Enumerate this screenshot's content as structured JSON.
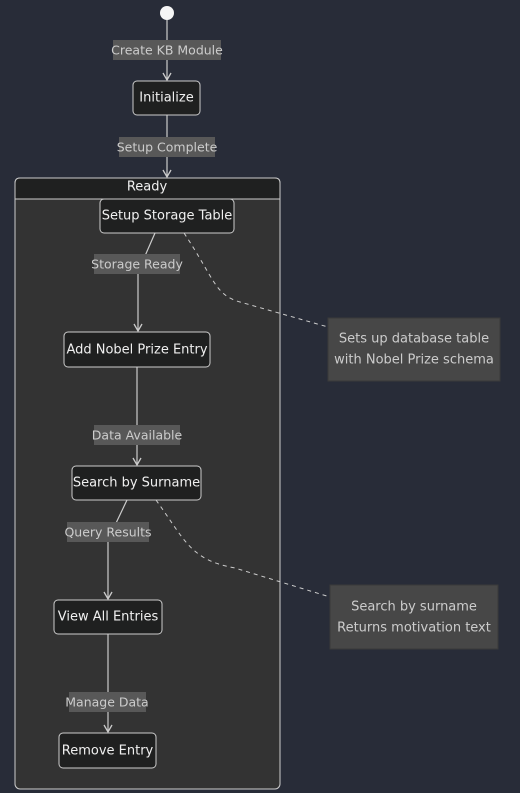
{
  "diagram": {
    "start": "start-state",
    "states": {
      "initialize": "Initialize",
      "ready": "Ready",
      "setup_storage": "Setup Storage Table",
      "add_entry": "Add Nobel Prize Entry",
      "search": "Search by Surname",
      "view_all": "View All Entries",
      "remove": "Remove Entry"
    },
    "transitions": {
      "create_kb": "Create KB Module",
      "setup_complete": "Setup Complete",
      "storage_ready": "Storage Ready",
      "data_available": "Data Available",
      "query_results": "Query Results",
      "manage_data": "Manage Data"
    },
    "notes": {
      "storage_note": [
        "Sets up database table",
        "with Nobel Prize schema"
      ],
      "search_note": [
        "Search by surname",
        "Returns motivation text"
      ]
    },
    "colors": {
      "background": "#282c38",
      "node": "#1f2020",
      "composite": "#333333",
      "edge_label": "#585858",
      "note": "#474747"
    }
  }
}
